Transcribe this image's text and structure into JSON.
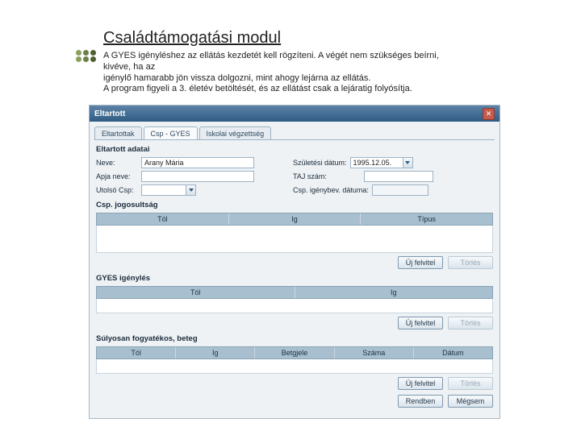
{
  "heading": "Családtámogatási modul",
  "paragraph_lines": [
    "A GYES igényléshez az ellátás kezdetét kell rögzíteni. A végét nem szükséges beírni,",
    "kivéve, ha az",
    "igénylő hamarabb jön vissza dolgozni, mint ahogy lejárna az ellátás.",
    "A program figyeli a 3. életév betöltését, és az ellátást csak a lejáratig folyósítja."
  ],
  "window": {
    "title": "Eltartott",
    "tabs": [
      "Eltartottak",
      "Csp - GYES",
      "Iskolai végzettség"
    ],
    "active_tab": 1,
    "section1": {
      "title": "Eltartott adatai",
      "labels": {
        "name": "Neve:",
        "birth": "Születési dátum:",
        "apa": "Apja neve:",
        "taj": "TAJ szám:",
        "utolso": "Utolsó Csp:",
        "csp_igeny": "Csp. igénybev. dátuma:"
      },
      "values": {
        "name": "Arany Mária",
        "birth": "1995.12.05."
      }
    },
    "grid1": {
      "title": "Csp. jogosultság",
      "cols": [
        "Tól",
        "Ig",
        "Típus"
      ]
    },
    "grid2": {
      "title": "GYES igénylés",
      "cols": [
        "Tól",
        "Ig"
      ]
    },
    "grid3": {
      "title": "Súlyosan fogyatékos, beteg",
      "cols": [
        "Tól",
        "Ig",
        "Betgjele",
        "Száma",
        "Dátum"
      ]
    },
    "buttons": {
      "uj": "Új felvitel",
      "torles": "Törlés",
      "rendben": "Rendben",
      "megsem": "Mégsem"
    }
  }
}
